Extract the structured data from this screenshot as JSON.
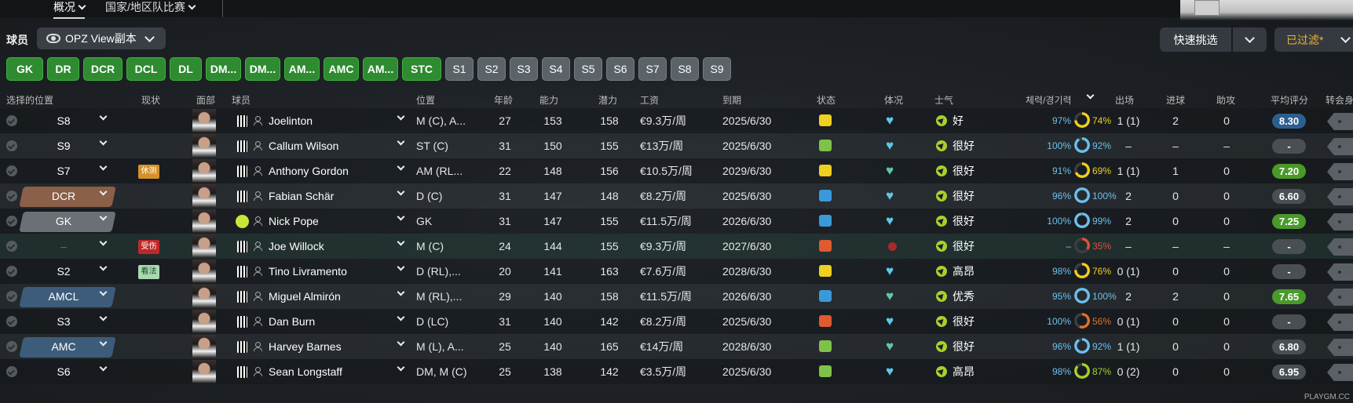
{
  "topnav": {
    "tabs": [
      {
        "label": "概况",
        "active": true
      },
      {
        "label": "国家/地区队比赛",
        "active": false
      }
    ]
  },
  "header": {
    "players_label": "球员",
    "view_name": "OPZ View副本",
    "quick_pick": "快速挑选",
    "filter": "已过滤*"
  },
  "positions": {
    "green": [
      "GK",
      "DR",
      "DCR",
      "DCL",
      "DL",
      "DM...",
      "DM...",
      "AM...",
      "AMC",
      "AM...",
      "STC"
    ],
    "grey": [
      "S1",
      "S2",
      "S3",
      "S4",
      "S5",
      "S6",
      "S7",
      "S8",
      "S9"
    ]
  },
  "columns": {
    "selected_pos": "选择的位置",
    "status_now": "现状",
    "face": "面部",
    "player": "球员",
    "position": "位置",
    "age": "年龄",
    "ability": "能力",
    "potential": "潜力",
    "wage": "工资",
    "expires": "到期",
    "state": "状态",
    "condition": "体况",
    "morale": "士气",
    "fitness": "체력/경기력",
    "apps": "出场",
    "goals": "进球",
    "assists": "助攻",
    "avg_rating": "平均评分",
    "transfer": "转会身价"
  },
  "colors": {
    "green_button": "#2e8b30",
    "grey_button": "#5c6368",
    "filter_text": "#f2b232",
    "fitness_blue": "#6cc0ec",
    "yellow": "#f0d020",
    "red": "#e05040",
    "rating_green": "#4a9a2a",
    "rating_blue": "#2d5f8e"
  },
  "players": [
    {
      "sel": "S8",
      "sel_style": "none",
      "badge": "",
      "badge_type": "",
      "shirt": "stripe",
      "name": "Joelinton",
      "pos": "M (C), A...",
      "age": "27",
      "ca": "153",
      "pa": "158",
      "wage": "€9.3万/周",
      "exp": "2025/6/30",
      "state_icon": "yellow",
      "heart": "blue",
      "morale": "好",
      "morale_icon": "green-up",
      "fit1": "97%",
      "fit2": "74%",
      "fit2_level": 0.74,
      "fit2_color": "#f0d020",
      "apps": "1 (1)",
      "goals": "2",
      "assists": "0",
      "rating": "8.30",
      "rating_style": "blue"
    },
    {
      "sel": "S9",
      "sel_style": "none",
      "badge": "",
      "badge_type": "",
      "shirt": "stripe",
      "name": "Callum Wilson",
      "pos": "ST (C)",
      "age": "31",
      "ca": "150",
      "pa": "155",
      "wage": "€13万/周",
      "exp": "2025/6/30",
      "state_icon": "green",
      "heart": "blue",
      "morale": "很好",
      "morale_icon": "green-up",
      "fit1": "100%",
      "fit2": "92%",
      "fit2_level": 0.92,
      "fit2_color": "#6cc0ec",
      "apps": "–",
      "goals": "–",
      "assists": "–",
      "rating": "-",
      "rating_style": "grey"
    },
    {
      "sel": "S7",
      "sel_style": "none",
      "badge": "休测",
      "badge_type": "orange",
      "shirt": "stripe",
      "name": "Anthony Gordon",
      "pos": "AM (RL...",
      "age": "22",
      "ca": "148",
      "pa": "156",
      "wage": "€10.5万/周",
      "exp": "2029/6/30",
      "state_icon": "yellow",
      "heart": "green",
      "morale": "很好",
      "morale_icon": "green-up",
      "fit1": "91%",
      "fit2": "69%",
      "fit2_level": 0.69,
      "fit2_color": "#f0d020",
      "apps": "1 (1)",
      "goals": "1",
      "assists": "0",
      "rating": "7.20",
      "rating_style": "green"
    },
    {
      "sel": "DCR",
      "sel_style": "brown",
      "badge": "",
      "badge_type": "",
      "shirt": "stripe",
      "name": "Fabian Schär",
      "pos": "D (C)",
      "age": "31",
      "ca": "147",
      "pa": "148",
      "wage": "€8.2万/周",
      "exp": "2025/6/30",
      "state_icon": "blue",
      "heart": "blue",
      "morale": "很好",
      "morale_icon": "green-up",
      "fit1": "96%",
      "fit2": "100%",
      "fit2_level": 1.0,
      "fit2_color": "#6cc0ec",
      "apps": "2",
      "goals": "0",
      "assists": "0",
      "rating": "6.60",
      "rating_style": "grey"
    },
    {
      "sel": "GK",
      "sel_style": "grey",
      "badge": "",
      "badge_type": "",
      "shirt": "gk",
      "name": "Nick Pope",
      "pos": "GK",
      "age": "31",
      "ca": "147",
      "pa": "155",
      "wage": "€11.5万/周",
      "exp": "2026/6/30",
      "state_icon": "blue",
      "heart": "blue",
      "morale": "很好",
      "morale_icon": "green-up",
      "fit1": "100%",
      "fit2": "99%",
      "fit2_level": 0.99,
      "fit2_color": "#6cc0ec",
      "apps": "2",
      "goals": "0",
      "assists": "0",
      "rating": "7.25",
      "rating_style": "green"
    },
    {
      "sel": "–",
      "sel_style": "none",
      "badge": "受伤",
      "badge_type": "red",
      "shirt": "stripe",
      "name": "Joe Willock",
      "pos": "M (C)",
      "age": "24",
      "ca": "144",
      "pa": "155",
      "wage": "€9.3万/周",
      "exp": "2027/6/30",
      "state_icon": "red",
      "heart": "reddot",
      "morale": "很好",
      "morale_icon": "green-up",
      "fit1": "–",
      "fit2": "35%",
      "fit2_level": 0.35,
      "fit2_color": "#e05040",
      "apps": "–",
      "goals": "–",
      "assists": "–",
      "rating": "-",
      "rating_style": "grey"
    },
    {
      "sel": "S2",
      "sel_style": "none",
      "badge": "看法",
      "badge_type": "green",
      "shirt": "stripe",
      "name": "Tino Livramento",
      "pos": "D (RL),...",
      "age": "20",
      "ca": "141",
      "pa": "163",
      "wage": "€7.6万/周",
      "exp": "2028/6/30",
      "state_icon": "yellow",
      "heart": "blue",
      "morale": "高昂",
      "morale_icon": "green-up",
      "fit1": "98%",
      "fit2": "76%",
      "fit2_level": 0.76,
      "fit2_color": "#f0d020",
      "apps": "0 (1)",
      "goals": "0",
      "assists": "0",
      "rating": "-",
      "rating_style": "grey"
    },
    {
      "sel": "AMCL",
      "sel_style": "blue",
      "badge": "",
      "badge_type": "",
      "shirt": "stripe",
      "name": "Miguel Almirón",
      "pos": "M (RL),...",
      "age": "29",
      "ca": "140",
      "pa": "158",
      "wage": "€11.5万/周",
      "exp": "2026/6/30",
      "state_icon": "blue",
      "heart": "green",
      "morale": "优秀",
      "morale_icon": "green-up",
      "fit1": "95%",
      "fit2": "100%",
      "fit2_level": 1.0,
      "fit2_color": "#6cc0ec",
      "apps": "2",
      "goals": "2",
      "assists": "0",
      "rating": "7.65",
      "rating_style": "green"
    },
    {
      "sel": "S3",
      "sel_style": "none",
      "badge": "",
      "badge_type": "",
      "shirt": "stripe",
      "name": "Dan Burn",
      "pos": "D (LC)",
      "age": "31",
      "ca": "140",
      "pa": "142",
      "wage": "€8.2万/周",
      "exp": "2025/6/30",
      "state_icon": "red",
      "heart": "blue",
      "morale": "很好",
      "morale_icon": "green-up",
      "fit1": "100%",
      "fit2": "56%",
      "fit2_level": 0.56,
      "fit2_color": "#e07030",
      "apps": "0 (1)",
      "goals": "0",
      "assists": "0",
      "rating": "-",
      "rating_style": "grey"
    },
    {
      "sel": "AMC",
      "sel_style": "blue",
      "badge": "",
      "badge_type": "",
      "shirt": "stripe",
      "name": "Harvey Barnes",
      "pos": "M (L), A...",
      "age": "25",
      "ca": "140",
      "pa": "165",
      "wage": "€14万/周",
      "exp": "2028/6/30",
      "state_icon": "green",
      "heart": "green",
      "morale": "很好",
      "morale_icon": "green-up",
      "fit1": "96%",
      "fit2": "92%",
      "fit2_level": 0.92,
      "fit2_color": "#6cc0ec",
      "apps": "1 (1)",
      "goals": "0",
      "assists": "0",
      "rating": "6.80",
      "rating_style": "grey"
    },
    {
      "sel": "S6",
      "sel_style": "none",
      "badge": "",
      "badge_type": "",
      "shirt": "stripe",
      "name": "Sean Longstaff",
      "pos": "DM, M (C)",
      "age": "25",
      "ca": "138",
      "pa": "142",
      "wage": "€3.5万/周",
      "exp": "2025/6/30",
      "state_icon": "green",
      "heart": "blue",
      "morale": "高昂",
      "morale_icon": "green-up",
      "fit1": "98%",
      "fit2": "87%",
      "fit2_level": 0.87,
      "fit2_color": "#a8d02d",
      "apps": "0 (2)",
      "goals": "0",
      "assists": "0",
      "rating": "6.95",
      "rating_style": "grey"
    }
  ],
  "watermark": "PLAYGM.CC"
}
